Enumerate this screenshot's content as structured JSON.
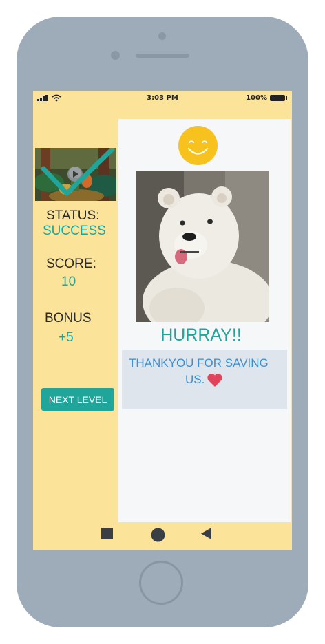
{
  "statusbar": {
    "time": "3:03 PM",
    "battery": "100%"
  },
  "sidebar": {
    "status_label": "STATUS:",
    "status_value": "SUCCESS",
    "score_label": "SCORE:",
    "score_value": "10",
    "bonus_label": "BONUS",
    "bonus_value": "+5",
    "next_level_label": "NEXT LEVEL"
  },
  "main": {
    "hurray": "HURRAY!!",
    "message_line1": "THANKYOU FOR SAVING",
    "message_line2": "US."
  },
  "icons": {
    "smiley": "smiley-face-icon",
    "heart": "heart-icon",
    "check": "checkmark-icon",
    "play": "play-icon",
    "nav_recent": "square-nav-icon",
    "nav_home": "circle-nav-icon",
    "nav_back": "back-triangle-icon"
  },
  "colors": {
    "background": "#fbe39a",
    "accent": "#1fa59a",
    "smiley": "#f7c21e",
    "heart": "#e0435a",
    "message_text": "#3b8fd0",
    "phone_frame": "#9eacb9"
  }
}
